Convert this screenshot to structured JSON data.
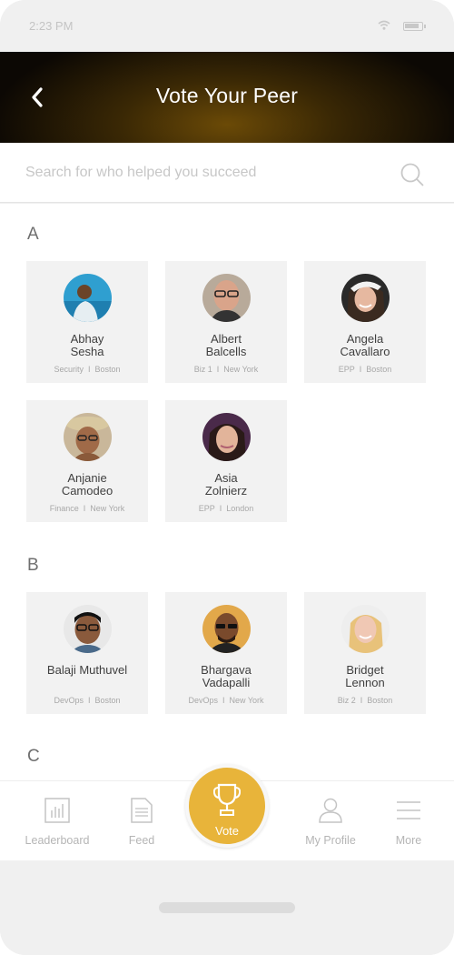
{
  "status_bar": {
    "time": "2:23 PM"
  },
  "header": {
    "title": "Vote Your Peer",
    "back_icon": "chevron-left-icon"
  },
  "search": {
    "placeholder": "Search for who helped you succeed",
    "value": "",
    "icon": "search-icon"
  },
  "sections": [
    {
      "letter": "A",
      "people": [
        {
          "first": "Abhay",
          "last": "Sesha",
          "department": "Security",
          "location": "Boston"
        },
        {
          "first": "Albert",
          "last": "Balcells",
          "department": "Biz 1",
          "location": "New York"
        },
        {
          "first": "Angela",
          "last": "Cavallaro",
          "department": "EPP",
          "location": "Boston"
        },
        {
          "first": "Anjanie",
          "last": "Camodeo",
          "department": "Finance",
          "location": "New York"
        },
        {
          "first": "Asia",
          "last": "Zolnierz",
          "department": "EPP",
          "location": "London"
        }
      ]
    },
    {
      "letter": "B",
      "people": [
        {
          "first": "Balaji Muthuvel",
          "last": "",
          "department": "DevOps",
          "location": "Boston"
        },
        {
          "first": "Bhargava",
          "last": "Vadapalli",
          "department": "DevOps",
          "location": "New York"
        },
        {
          "first": "Bridget",
          "last": "Lennon",
          "department": "Biz 2",
          "location": "Boston"
        }
      ]
    },
    {
      "letter": "C",
      "people": []
    }
  ],
  "meta_separator": "I",
  "tabs": [
    {
      "label": "Leaderboard",
      "icon": "bar-chart-icon"
    },
    {
      "label": "Feed",
      "icon": "document-icon"
    },
    {
      "label": "Vote",
      "icon": "trophy-icon"
    },
    {
      "label": "My Profile",
      "icon": "user-icon"
    },
    {
      "label": "More",
      "icon": "menu-icon"
    }
  ],
  "colors": {
    "accent": "#e8b43a",
    "header_dark": "#0c0804",
    "header_glow": "#6b4a06"
  }
}
